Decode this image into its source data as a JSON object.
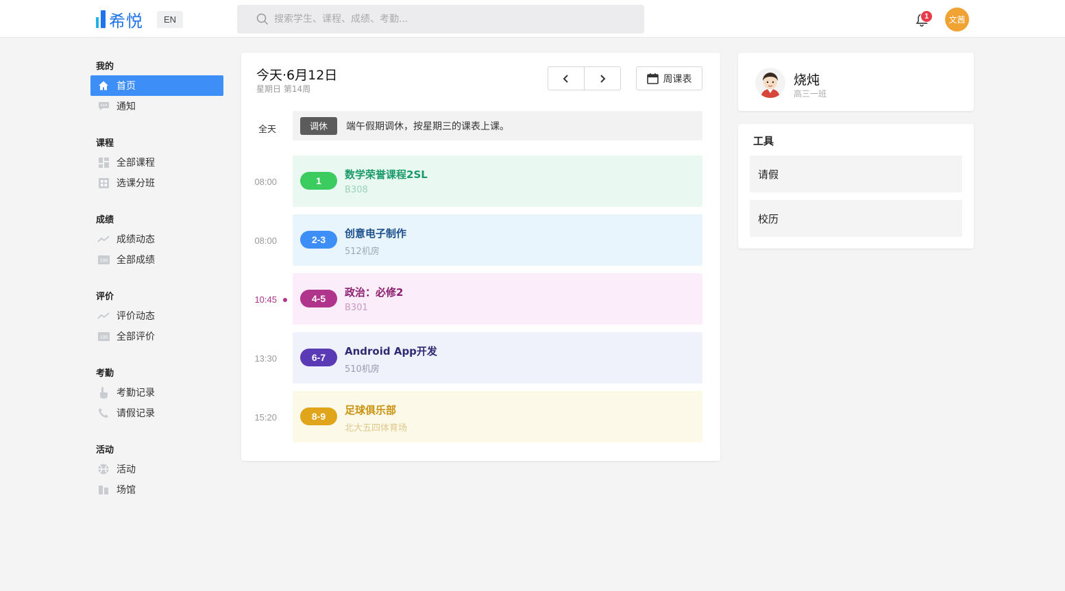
{
  "header": {
    "logo_text": "希悦",
    "lang_label": "EN",
    "search_placeholder": "搜索学生、课程、成绩、考勤...",
    "notification_count": "1",
    "user_initials": "文茜",
    "brand_color": "#1e74e8"
  },
  "sidebar": {
    "sections": [
      {
        "title": "我的",
        "items": [
          {
            "label": "首页",
            "icon": "home-icon",
            "active": true
          },
          {
            "label": "通知",
            "icon": "message-icon"
          }
        ]
      },
      {
        "title": "课程",
        "items": [
          {
            "label": "全部课程",
            "icon": "dashboard-icon"
          },
          {
            "label": "选课分班",
            "icon": "grid-icon"
          }
        ]
      },
      {
        "title": "成绩",
        "items": [
          {
            "label": "成绩动态",
            "icon": "trend-icon"
          },
          {
            "label": "全部成绩",
            "icon": "score-100-icon"
          }
        ]
      },
      {
        "title": "评价",
        "items": [
          {
            "label": "评价动态",
            "icon": "trend-icon"
          },
          {
            "label": "全部评价",
            "icon": "score-100-icon"
          }
        ]
      },
      {
        "title": "考勤",
        "items": [
          {
            "label": "考勤记录",
            "icon": "hand-icon"
          },
          {
            "label": "请假记录",
            "icon": "phone-icon"
          }
        ]
      },
      {
        "title": "活动",
        "items": [
          {
            "label": "活动",
            "icon": "ball-icon"
          },
          {
            "label": "场馆",
            "icon": "building-icon"
          }
        ]
      }
    ],
    "active_color": "#3e8ef7"
  },
  "schedule": {
    "date_title": "今天·6月12日",
    "date_sub": "星期日  第14周",
    "prev_icon": "chevron-left-icon",
    "next_icon": "chevron-right-icon",
    "week_button": "周课表",
    "allday": {
      "label": "全天",
      "tag": "调休",
      "text": "端午假期调休，按星期三的课表上课。"
    },
    "current_time": "10:45",
    "courses": [
      {
        "time": "08:00",
        "period": "1",
        "name": "数学荣誉课程2SL",
        "room": "B308",
        "accent": "#3ccb5f",
        "bg": "#eaf8f2",
        "name_color": "#1a9a6a",
        "room_color": "#9ad3bb"
      },
      {
        "time": "08:00",
        "period": "2-3",
        "name": "创意电子制作",
        "room": "512机房",
        "accent": "#3e8ef7",
        "bg": "#e8f5fc",
        "name_color": "#1d4f8c",
        "room_color": "#9aa9b6"
      },
      {
        "time": "10:45",
        "period": "4-5",
        "name": "政治：必修2",
        "room": "B301",
        "accent": "#b0338c",
        "bg": "#fbeefa",
        "name_color": "#8c2070",
        "room_color": "#c79ac0",
        "current": true
      },
      {
        "time": "13:30",
        "period": "6-7",
        "name": "Android App开发",
        "room": "510机房",
        "accent": "#5b3bb5",
        "bg": "#eff1fb",
        "name_color": "#2e2a73",
        "room_color": "#9a9ab0"
      },
      {
        "time": "15:20",
        "period": "8-9",
        "name": "足球俱乐部",
        "room": "北大五四体育场",
        "accent": "#e0a51a",
        "bg": "#fdf9e8",
        "name_color": "#c9930f",
        "room_color": "#dfc88c"
      }
    ]
  },
  "profile": {
    "name": "烧炖",
    "class": "高三一班"
  },
  "tools": {
    "title": "工具",
    "items": [
      "请假",
      "校历"
    ]
  }
}
